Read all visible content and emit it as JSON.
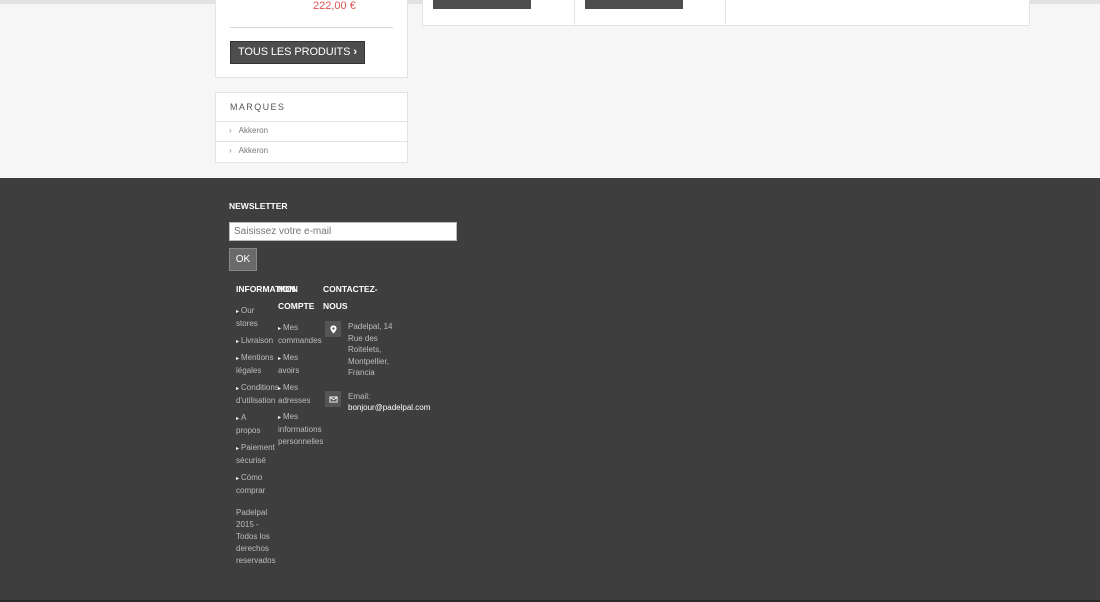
{
  "sidebar": {
    "products": {
      "price": "222,00 €",
      "all_products_label": "TOUS LES PRODUITS"
    },
    "brands": {
      "title": "MARQUES",
      "items": [
        "Akkeron",
        "Akkeron"
      ]
    }
  },
  "footer": {
    "newsletter": {
      "title": "NEWSLETTER",
      "placeholder": "Saisissez votre e-mail",
      "ok_label": "OK"
    },
    "information": {
      "title": "INFORMATION",
      "links": [
        "Our stores",
        "Livraison",
        "Mentions légales",
        "Conditions d'utilisation",
        "A propos",
        "Paiement sécurisé",
        "Cómo comprar"
      ]
    },
    "account": {
      "title": "MON COMPTE",
      "links": [
        "Mes commandes",
        "Mes avoirs",
        "Mes adresses",
        "Mes informations personnelles"
      ]
    },
    "contact": {
      "title": "CONTACTEZ-NOUS",
      "address": "Padelpal, 14 Rue des Roitelets, Montpellier, Francia",
      "email_label": "Email:",
      "email": "bonjour@padelpal.com"
    },
    "copyright": "Padelpal 2015 - Todos los derechos reservados"
  },
  "colors": {
    "footer_bg": "#3e3e3e",
    "price": "#d9534f",
    "button_dark": "#4d4d4d"
  }
}
